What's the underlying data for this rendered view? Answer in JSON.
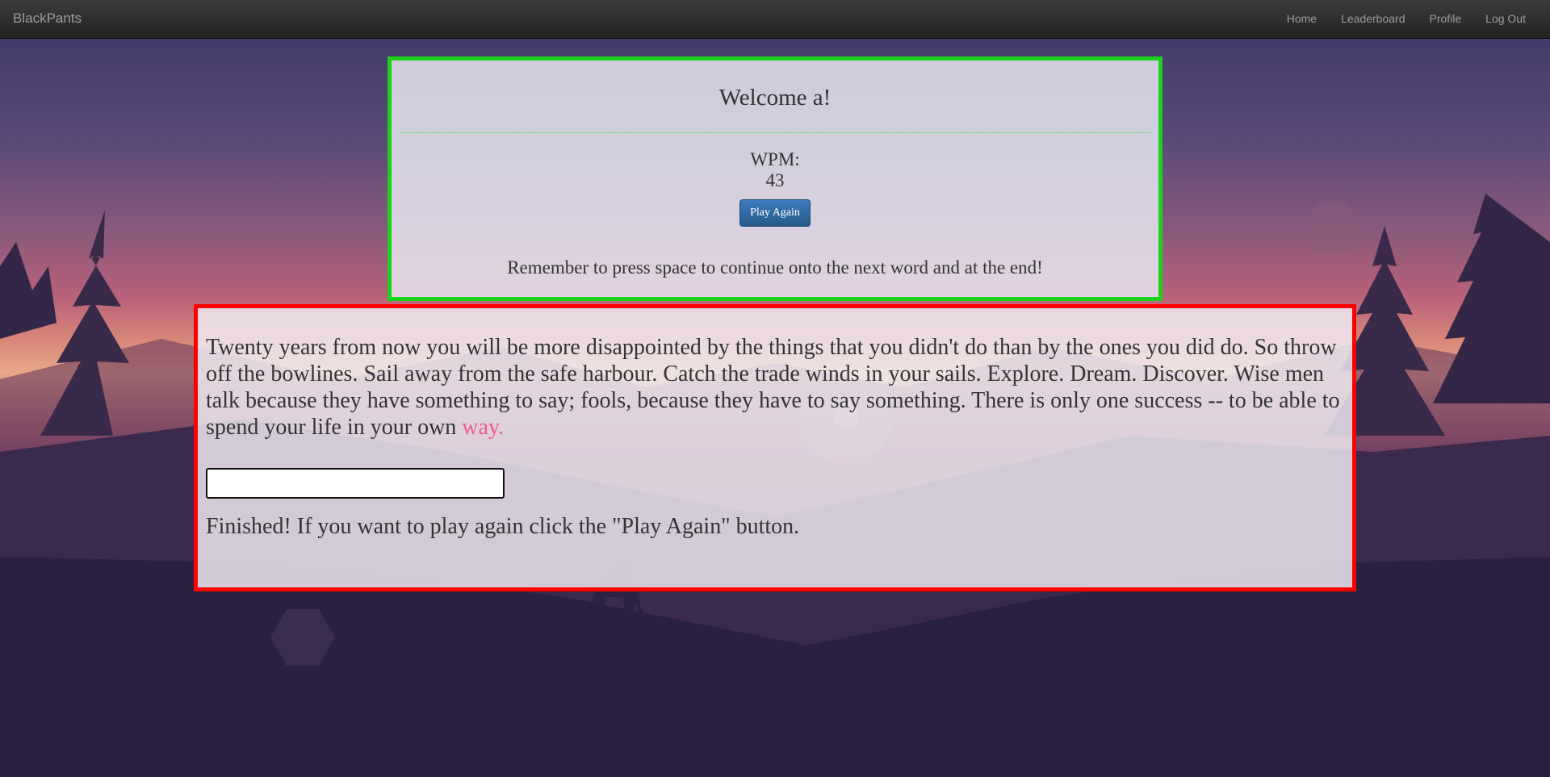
{
  "navbar": {
    "brand": "BlackPants",
    "links": [
      "Home",
      "Leaderboard",
      "Profile",
      "Log Out"
    ]
  },
  "welcome": {
    "title": "Welcome a!",
    "wpm_label": "WPM:",
    "wpm_value": "43",
    "play_again_label": "Play Again",
    "reminder": "Remember to press space to continue onto the next word and at the end!"
  },
  "typing": {
    "passage_before": "Twenty years from now you will be more disappointed by the things that you didn't do than by the ones you did do. So throw off the bowlines. Sail away from the safe harbour. Catch the trade winds in your sails. Explore. Dream. Discover. Wise men talk because they have something to say; fools, because they have to say something. There is only one success -- to be able to spend your life in your own ",
    "passage_current_word": "way.",
    "input_value": "",
    "finished_message": "Finished! If you want to play again click the \"Play Again\" button."
  },
  "colors": {
    "welcome_border": "#19d219",
    "typing_border": "#ff0000",
    "current_word": "#ee5b8e",
    "button": "#2a6496"
  }
}
